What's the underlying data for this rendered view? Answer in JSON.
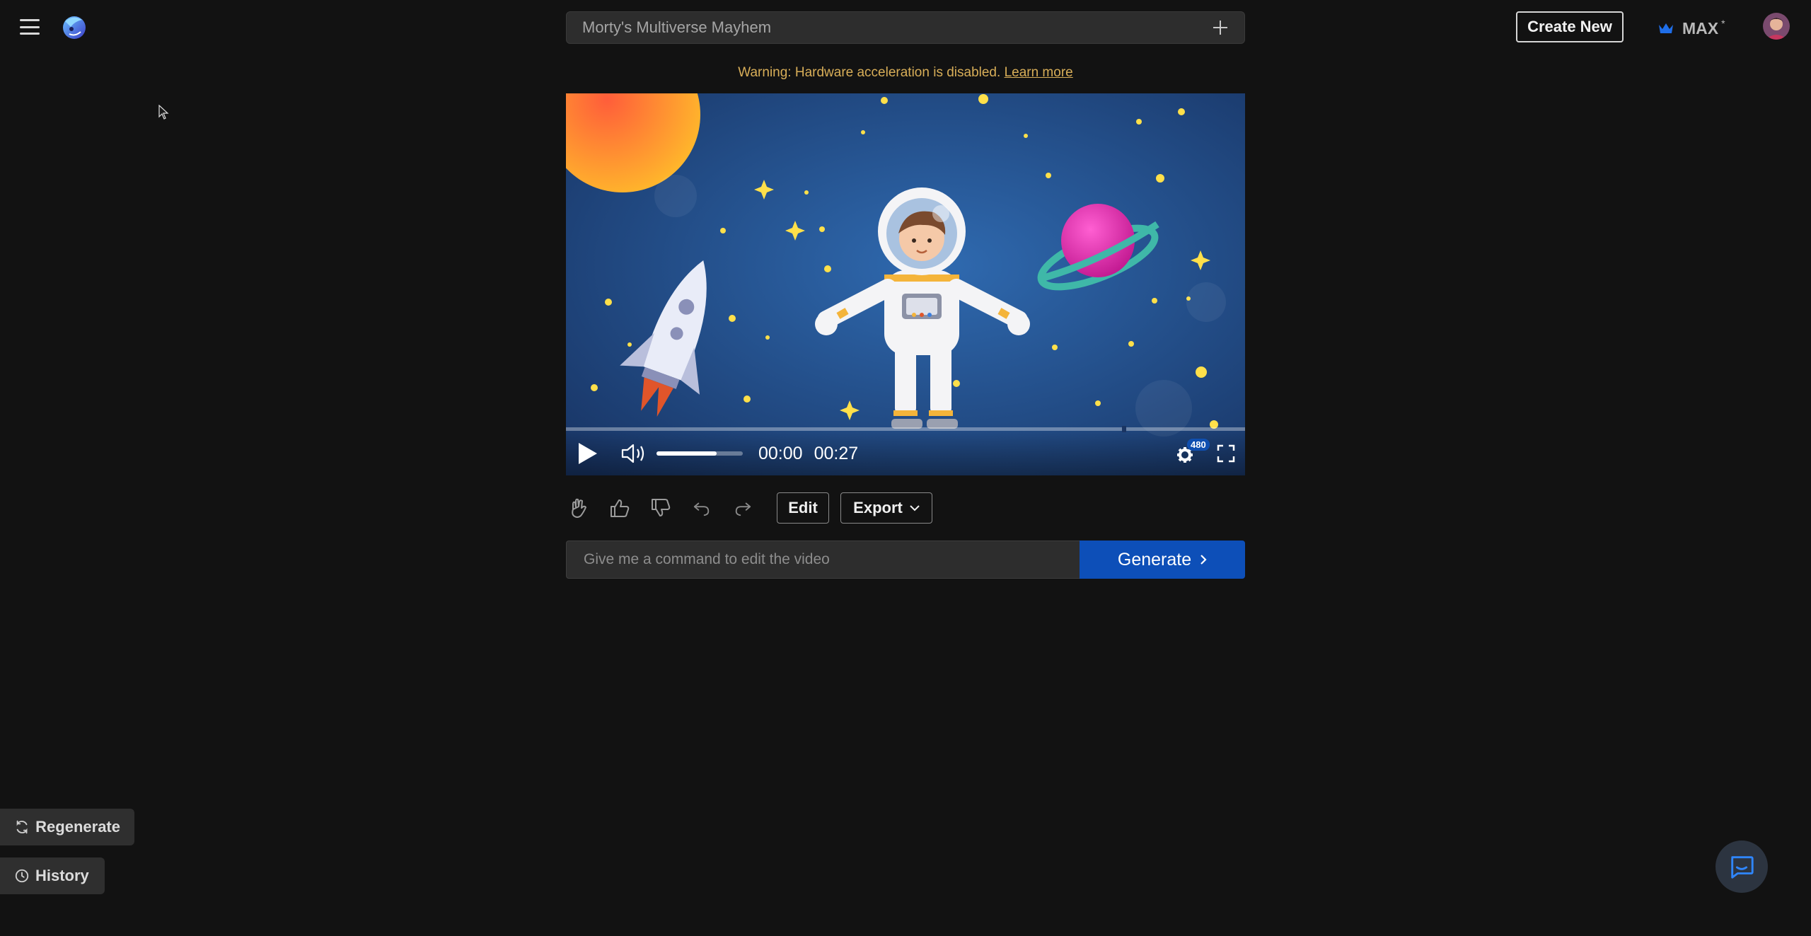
{
  "header": {
    "project_title": "Morty's Multiverse Mayhem",
    "create_new_label": "Create New",
    "plan_label": "MAX",
    "plan_marker": "*"
  },
  "warning": {
    "text": "Warning: Hardware acceleration is disabled. ",
    "link_label": "Learn more"
  },
  "player": {
    "current_time": "00:00",
    "duration": "00:27",
    "quality_badge": "480",
    "volume_level": 0.7,
    "progress_fraction": 0.0
  },
  "actions": {
    "edit_label": "Edit",
    "export_label": "Export"
  },
  "command": {
    "placeholder": "Give me a command to edit the video",
    "generate_label": "Generate"
  },
  "sidebar": {
    "regenerate_label": "Regenerate",
    "history_label": "History"
  },
  "colors": {
    "background": "#121212",
    "accent_blue": "#0d4fb8",
    "warning": "#d8ae58"
  }
}
